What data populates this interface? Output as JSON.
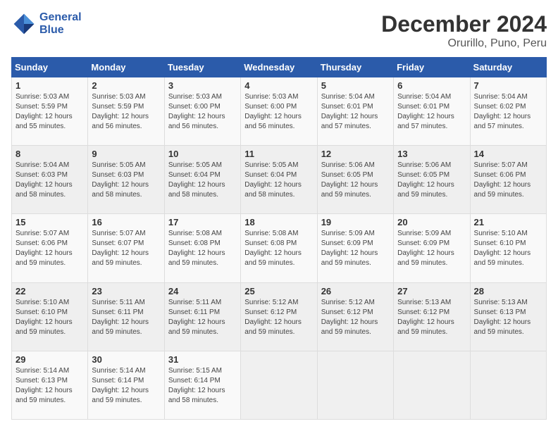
{
  "logo": {
    "line1": "General",
    "line2": "Blue"
  },
  "title": "December 2024",
  "subtitle": "Orurillo, Puno, Peru",
  "weekdays": [
    "Sunday",
    "Monday",
    "Tuesday",
    "Wednesday",
    "Thursday",
    "Friday",
    "Saturday"
  ],
  "weeks": [
    [
      {
        "day": "1",
        "info": "Sunrise: 5:03 AM\nSunset: 5:59 PM\nDaylight: 12 hours\nand 55 minutes."
      },
      {
        "day": "2",
        "info": "Sunrise: 5:03 AM\nSunset: 5:59 PM\nDaylight: 12 hours\nand 56 minutes."
      },
      {
        "day": "3",
        "info": "Sunrise: 5:03 AM\nSunset: 6:00 PM\nDaylight: 12 hours\nand 56 minutes."
      },
      {
        "day": "4",
        "info": "Sunrise: 5:03 AM\nSunset: 6:00 PM\nDaylight: 12 hours\nand 56 minutes."
      },
      {
        "day": "5",
        "info": "Sunrise: 5:04 AM\nSunset: 6:01 PM\nDaylight: 12 hours\nand 57 minutes."
      },
      {
        "day": "6",
        "info": "Sunrise: 5:04 AM\nSunset: 6:01 PM\nDaylight: 12 hours\nand 57 minutes."
      },
      {
        "day": "7",
        "info": "Sunrise: 5:04 AM\nSunset: 6:02 PM\nDaylight: 12 hours\nand 57 minutes."
      }
    ],
    [
      {
        "day": "8",
        "info": "Sunrise: 5:04 AM\nSunset: 6:03 PM\nDaylight: 12 hours\nand 58 minutes."
      },
      {
        "day": "9",
        "info": "Sunrise: 5:05 AM\nSunset: 6:03 PM\nDaylight: 12 hours\nand 58 minutes."
      },
      {
        "day": "10",
        "info": "Sunrise: 5:05 AM\nSunset: 6:04 PM\nDaylight: 12 hours\nand 58 minutes."
      },
      {
        "day": "11",
        "info": "Sunrise: 5:05 AM\nSunset: 6:04 PM\nDaylight: 12 hours\nand 58 minutes."
      },
      {
        "day": "12",
        "info": "Sunrise: 5:06 AM\nSunset: 6:05 PM\nDaylight: 12 hours\nand 59 minutes."
      },
      {
        "day": "13",
        "info": "Sunrise: 5:06 AM\nSunset: 6:05 PM\nDaylight: 12 hours\nand 59 minutes."
      },
      {
        "day": "14",
        "info": "Sunrise: 5:07 AM\nSunset: 6:06 PM\nDaylight: 12 hours\nand 59 minutes."
      }
    ],
    [
      {
        "day": "15",
        "info": "Sunrise: 5:07 AM\nSunset: 6:06 PM\nDaylight: 12 hours\nand 59 minutes."
      },
      {
        "day": "16",
        "info": "Sunrise: 5:07 AM\nSunset: 6:07 PM\nDaylight: 12 hours\nand 59 minutes."
      },
      {
        "day": "17",
        "info": "Sunrise: 5:08 AM\nSunset: 6:08 PM\nDaylight: 12 hours\nand 59 minutes."
      },
      {
        "day": "18",
        "info": "Sunrise: 5:08 AM\nSunset: 6:08 PM\nDaylight: 12 hours\nand 59 minutes."
      },
      {
        "day": "19",
        "info": "Sunrise: 5:09 AM\nSunset: 6:09 PM\nDaylight: 12 hours\nand 59 minutes."
      },
      {
        "day": "20",
        "info": "Sunrise: 5:09 AM\nSunset: 6:09 PM\nDaylight: 12 hours\nand 59 minutes."
      },
      {
        "day": "21",
        "info": "Sunrise: 5:10 AM\nSunset: 6:10 PM\nDaylight: 12 hours\nand 59 minutes."
      }
    ],
    [
      {
        "day": "22",
        "info": "Sunrise: 5:10 AM\nSunset: 6:10 PM\nDaylight: 12 hours\nand 59 minutes."
      },
      {
        "day": "23",
        "info": "Sunrise: 5:11 AM\nSunset: 6:11 PM\nDaylight: 12 hours\nand 59 minutes."
      },
      {
        "day": "24",
        "info": "Sunrise: 5:11 AM\nSunset: 6:11 PM\nDaylight: 12 hours\nand 59 minutes."
      },
      {
        "day": "25",
        "info": "Sunrise: 5:12 AM\nSunset: 6:12 PM\nDaylight: 12 hours\nand 59 minutes."
      },
      {
        "day": "26",
        "info": "Sunrise: 5:12 AM\nSunset: 6:12 PM\nDaylight: 12 hours\nand 59 minutes."
      },
      {
        "day": "27",
        "info": "Sunrise: 5:13 AM\nSunset: 6:12 PM\nDaylight: 12 hours\nand 59 minutes."
      },
      {
        "day": "28",
        "info": "Sunrise: 5:13 AM\nSunset: 6:13 PM\nDaylight: 12 hours\nand 59 minutes."
      }
    ],
    [
      {
        "day": "29",
        "info": "Sunrise: 5:14 AM\nSunset: 6:13 PM\nDaylight: 12 hours\nand 59 minutes."
      },
      {
        "day": "30",
        "info": "Sunrise: 5:14 AM\nSunset: 6:14 PM\nDaylight: 12 hours\nand 59 minutes."
      },
      {
        "day": "31",
        "info": "Sunrise: 5:15 AM\nSunset: 6:14 PM\nDaylight: 12 hours\nand 58 minutes."
      },
      null,
      null,
      null,
      null
    ]
  ]
}
